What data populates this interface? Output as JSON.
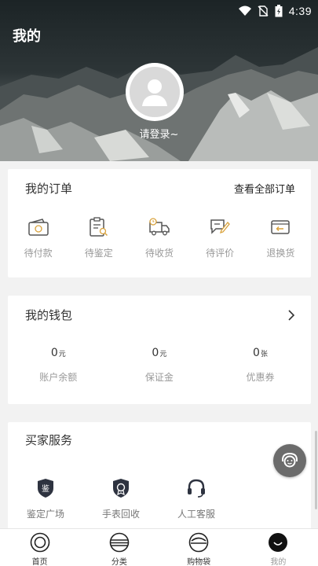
{
  "status": {
    "time": "4:39"
  },
  "header": {
    "title": "我的",
    "login_text": "请登录~"
  },
  "orders": {
    "title": "我的订单",
    "view_all": "查看全部订单",
    "items": [
      {
        "label": "待付款",
        "icon": "wallet-icon"
      },
      {
        "label": "待鉴定",
        "icon": "clipboard-search-icon"
      },
      {
        "label": "待收货",
        "icon": "truck-icon"
      },
      {
        "label": "待评价",
        "icon": "edit-review-icon"
      },
      {
        "label": "退换货",
        "icon": "return-icon"
      }
    ]
  },
  "wallet": {
    "title": "我的钱包",
    "items": [
      {
        "value": "0",
        "unit": "元",
        "label": "账户余额"
      },
      {
        "value": "0",
        "unit": "元",
        "label": "保证金"
      },
      {
        "value": "0",
        "unit": "张",
        "label": "优惠券"
      }
    ]
  },
  "services": {
    "title": "买家服务",
    "items": [
      {
        "label": "鉴定广场",
        "icon": "appraisal-shield-icon",
        "badge": "鉴"
      },
      {
        "label": "手表回收",
        "icon": "watch-recycle-icon"
      },
      {
        "label": "人工客服",
        "icon": "headset-icon"
      }
    ]
  },
  "tabbar": {
    "items": [
      {
        "label": "首页",
        "icon": "home-icon"
      },
      {
        "label": "分类",
        "icon": "category-icon"
      },
      {
        "label": "购物袋",
        "icon": "bag-icon"
      },
      {
        "label": "我的",
        "icon": "profile-icon",
        "active": true
      }
    ]
  },
  "colors": {
    "accent": "#222222",
    "muted": "#999999",
    "background": "#f2f2f2"
  }
}
